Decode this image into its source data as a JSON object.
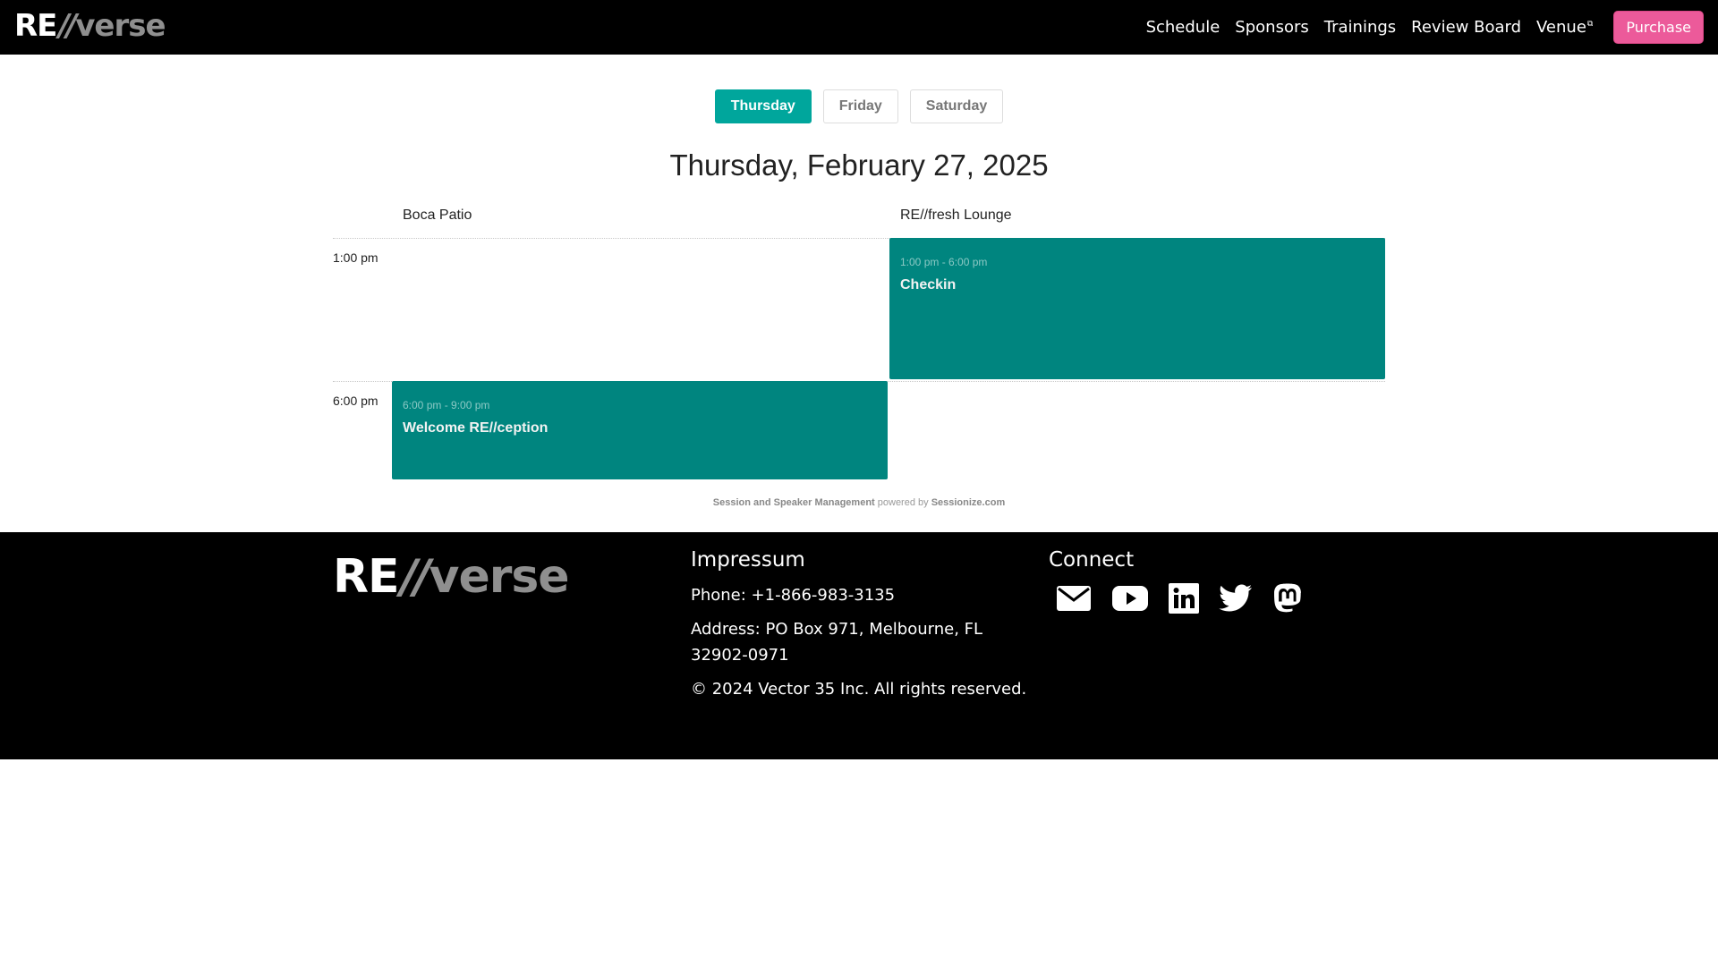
{
  "header": {
    "logo": {
      "re": "RE",
      "slash": "//",
      "verse": "verse"
    },
    "nav": [
      {
        "label": "Schedule",
        "external": false
      },
      {
        "label": "Sponsors",
        "external": false
      },
      {
        "label": "Trainings",
        "external": false
      },
      {
        "label": "Review Board",
        "external": false
      },
      {
        "label": "Venue",
        "external": true,
        "external_glyph": "⧉"
      }
    ],
    "purchase_label": "Purchase",
    "purchase_color": "#ec5a9a"
  },
  "schedule": {
    "days": [
      {
        "label": "Thursday",
        "active": true
      },
      {
        "label": "Friday",
        "active": false
      },
      {
        "label": "Saturday",
        "active": false
      }
    ],
    "date_title": "Thursday, February 27, 2025",
    "rooms": [
      "Boca Patio",
      "RE//fresh Lounge"
    ],
    "time_slots": [
      "1:00 pm",
      "6:00 pm"
    ],
    "sessions": [
      {
        "room": "RE//fresh Lounge",
        "time": "1:00 pm - 6:00 pm",
        "title": "Checkin"
      },
      {
        "room": "Boca Patio",
        "time": "6:00 pm - 9:00 pm",
        "title": "Welcome RE//ception"
      }
    ],
    "accent_color": "#00857f",
    "active_tab_color": "#00a69c"
  },
  "powered": {
    "left_link": "Session and Speaker Management",
    "middle": " powered by ",
    "right_link": "Sessionize.com"
  },
  "footer": {
    "logo": {
      "re": "RE",
      "slash": "//",
      "verse": "verse"
    },
    "impressum": {
      "heading": "Impressum",
      "phone": "Phone: +1-866-983-3135",
      "address": "Address: PO Box 971, Melbourne, FL 32902-0971",
      "copyright": "© 2024 Vector 35 Inc. All rights reserved."
    },
    "connect": {
      "heading": "Connect",
      "icons": [
        "email-icon",
        "youtube-icon",
        "linkedin-icon",
        "twitter-icon",
        "mastodon-icon"
      ]
    }
  }
}
